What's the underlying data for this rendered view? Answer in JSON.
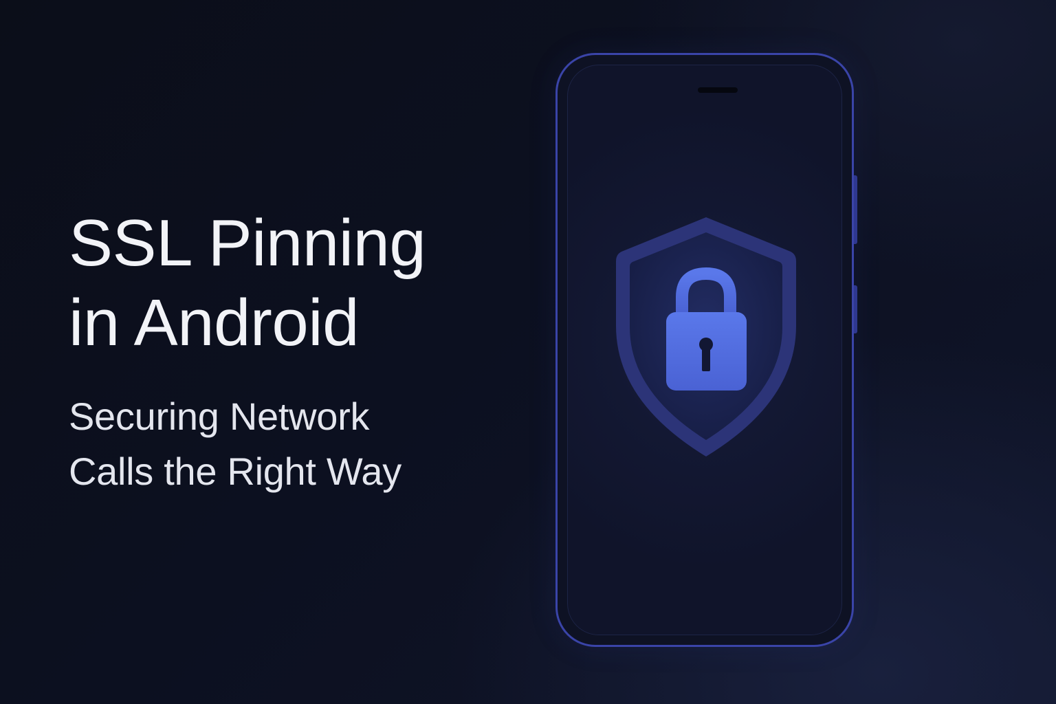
{
  "hero": {
    "title_lines": [
      "SSL Pinning",
      "in Android"
    ],
    "subtitle_lines": [
      "Securing Network",
      "Calls the Right Way"
    ]
  },
  "illustration": {
    "device": "smartphone",
    "icon": "shield-lock-icon",
    "colors": {
      "background": "#0c1020",
      "phone_outline": "#3a44a8",
      "shield_outer": "#2c3478",
      "shield_inner": "#1a2250",
      "lock": "#5470e0"
    }
  }
}
